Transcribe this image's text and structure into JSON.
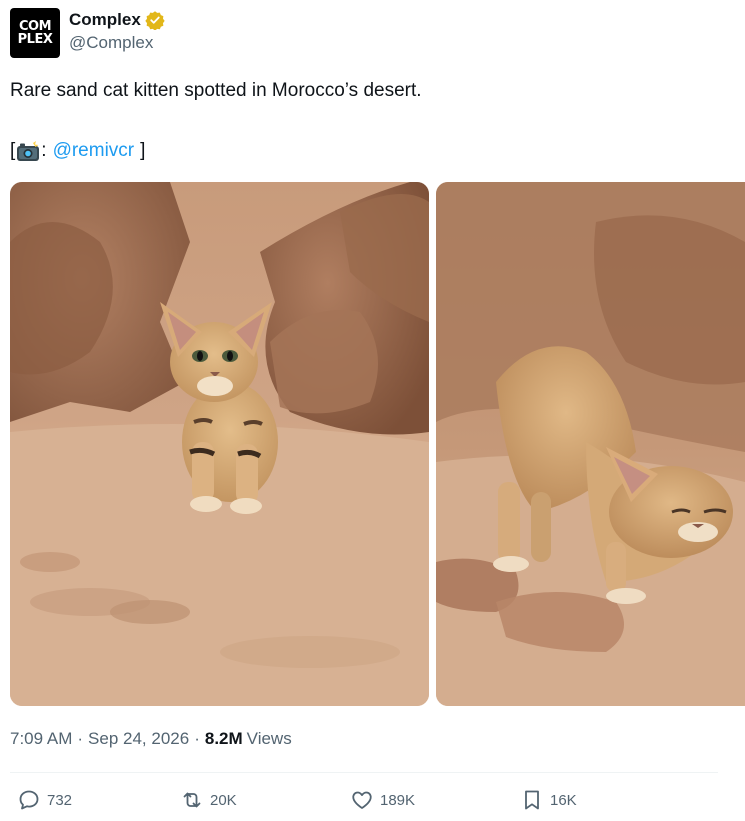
{
  "account": {
    "avatar_text_top": "COM",
    "avatar_text_bottom": "PLEX",
    "display_name": "Complex",
    "handle": "@Complex",
    "verified_color": "#e2b719"
  },
  "tweet": {
    "text": "Rare sand cat kitten spotted in Morocco’s desert.",
    "credit_open": "[",
    "credit_icon": "camera-flash-icon",
    "credit_colon": ":",
    "credit_handle": "@remivcr",
    "credit_close": "]"
  },
  "meta": {
    "time": "7:09 AM",
    "separator": "·",
    "date": "Sep 24, 2026",
    "views_count": "8.2M",
    "views_label": "Views"
  },
  "actions": {
    "replies": "732",
    "reposts": "20K",
    "likes": "189K",
    "bookmarks": "16K"
  },
  "colors": {
    "link": "#1d9bf0",
    "secondary_text": "#536471",
    "primary_text": "#0f1419"
  }
}
